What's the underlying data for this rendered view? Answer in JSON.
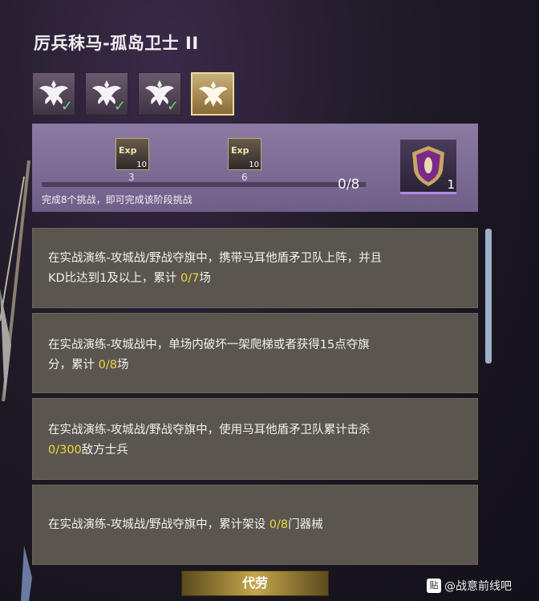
{
  "header": {
    "title": "厉兵秣马-孤岛卫士 II"
  },
  "tiers": [
    {
      "icon": "eagle-crest-icon",
      "completed": true
    },
    {
      "icon": "eagle-crest-icon",
      "completed": true
    },
    {
      "icon": "eagle-crest-icon",
      "completed": true
    },
    {
      "icon": "eagle-crest-icon",
      "completed": false,
      "selected": true
    }
  ],
  "check_glyph": "✓",
  "rewards": {
    "milestones": [
      {
        "icon": "exp-book-icon",
        "label": "Exp",
        "quantity": "10",
        "threshold": "3"
      },
      {
        "icon": "exp-book-icon",
        "label": "Exp",
        "quantity": "10",
        "threshold": "6"
      }
    ],
    "progress": {
      "current": 0,
      "total": 8,
      "text": "0/8"
    },
    "hint": "完成8个挑战，即可完成该阶段挑战",
    "final": {
      "icon": "shield-emblem-icon",
      "quantity": "1"
    }
  },
  "tasks": [
    {
      "line1": "在实战演练-攻城战/野战夺旗中，携带马耳他盾矛卫队上阵，并且",
      "line2_prefix": "KD比达到1及以上，累计 ",
      "progress": "0/7",
      "suffix": "场"
    },
    {
      "line1": "在实战演练-攻城战中，单场内破坏一架爬梯或者获得15点夺旗",
      "line2_prefix": "分，累计 ",
      "progress": "0/8",
      "suffix": "场"
    },
    {
      "line1": "在实战演练-攻城战/野战夺旗中，使用马耳他盾矛卫队累计击杀",
      "line2_prefix": "",
      "progress": "0/300",
      "suffix": "敌方士兵"
    },
    {
      "line1_prefix": "在实战演练-攻城战/野战夺旗中，累计架设 ",
      "progress": "0/8",
      "suffix": "门器械"
    }
  ],
  "footer": {
    "proxy_button": "代劳"
  },
  "watermark": {
    "badge": "贴",
    "text": "@战意前线吧"
  },
  "colors": {
    "highlight": "#f0d840",
    "progress_fill": "#b9a6d8",
    "panel": "#6f5f88",
    "task_bg": "#5a564f"
  }
}
